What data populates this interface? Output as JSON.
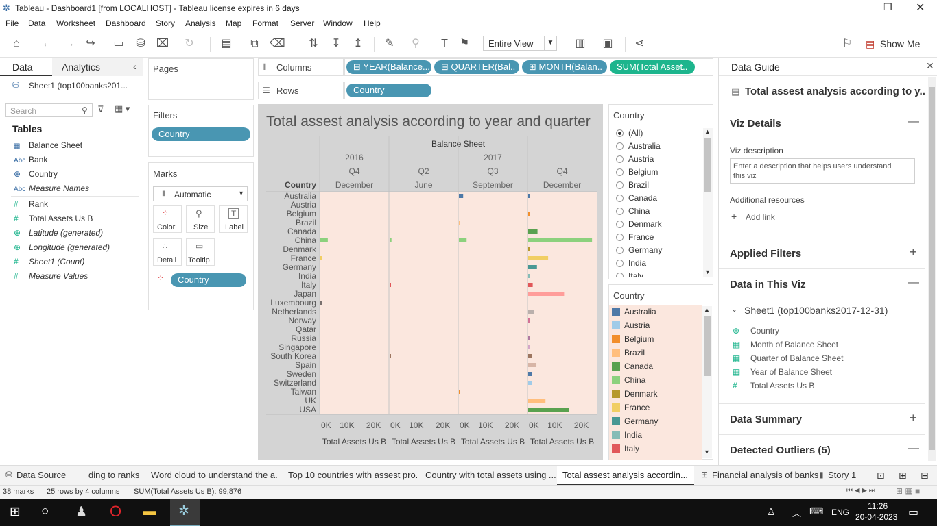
{
  "window": {
    "title": "Tableau - Dashboard1 [from LOCALHOST] - Tableau license expires in 6 days"
  },
  "menu": [
    "File",
    "Data",
    "Worksheet",
    "Dashboard",
    "Story",
    "Analysis",
    "Map",
    "Format",
    "Server",
    "Window",
    "Help"
  ],
  "toolbar": {
    "view_mode": "Entire View",
    "show_me": "Show Me"
  },
  "left_pane": {
    "tabs": [
      "Data",
      "Analytics"
    ],
    "datasource": "Sheet1 (top100banks201...",
    "search_placeholder": "Search",
    "tables_header": "Tables",
    "fields": [
      {
        "icon": "calendar",
        "name": "Balance Sheet",
        "italic": false
      },
      {
        "icon": "Abc",
        "name": "Bank",
        "italic": false
      },
      {
        "icon": "globe",
        "name": "Country",
        "italic": false
      },
      {
        "icon": "Abc",
        "name": "Measure Names",
        "italic": true
      },
      {
        "icon": "#",
        "name": "Rank",
        "italic": false
      },
      {
        "icon": "#",
        "name": "Total Assets Us B",
        "italic": false
      },
      {
        "icon": "globe",
        "name": "Latitude (generated)",
        "italic": true
      },
      {
        "icon": "globe",
        "name": "Longitude (generated)",
        "italic": true
      },
      {
        "icon": "#",
        "name": "Sheet1 (Count)",
        "italic": true
      },
      {
        "icon": "#",
        "name": "Measure Values",
        "italic": true
      }
    ]
  },
  "cards": {
    "pages": "Pages",
    "filters": "Filters",
    "filter_pill": "Country",
    "marks": "Marks",
    "marks_type": "Automatic",
    "mark_buttons": [
      "Color",
      "Size",
      "Label",
      "Detail",
      "Tooltip"
    ],
    "marks_pill": "Country"
  },
  "shelves": {
    "columns_label": "Columns",
    "rows_label": "Rows",
    "columns": [
      "YEAR(Balance...",
      "QUARTER(Bal..",
      "MONTH(Balan..",
      "SUM(Total Asset.."
    ],
    "rows": [
      "Country"
    ]
  },
  "chart_data": {
    "type": "bar",
    "title": "Total assest analysis according to year and quarter",
    "header_top": "Balance Sheet",
    "row_header": "Country",
    "categories": [
      "Australia",
      "Austria",
      "Belgium",
      "Brazil",
      "Canada",
      "China",
      "Denmark",
      "France",
      "Germany",
      "India",
      "Italy",
      "Japan",
      "Luxembourg",
      "Netherlands",
      "Norway",
      "Qatar",
      "Russia",
      "Singapore",
      "South Korea",
      "Spain",
      "Sweden",
      "Switzerland",
      "Taiwan",
      "UK",
      "USA"
    ],
    "panels": [
      {
        "year": "2016",
        "quarter": "Q4",
        "month": "December",
        "values": [
          0,
          0,
          0,
          0,
          0,
          2800,
          0,
          600,
          0,
          0,
          0,
          0,
          300,
          0,
          0,
          0,
          0,
          0,
          0,
          0,
          0,
          0,
          0,
          0,
          0
        ]
      },
      {
        "year": "",
        "quarter": "Q2",
        "month": "June",
        "values": [
          0,
          0,
          0,
          0,
          0,
          700,
          0,
          0,
          0,
          0,
          200,
          0,
          0,
          0,
          0,
          0,
          0,
          0,
          200,
          0,
          0,
          0,
          0,
          0,
          0
        ]
      },
      {
        "year": "2017",
        "quarter": "Q3",
        "month": "September",
        "values": [
          1600,
          0,
          0,
          300,
          0,
          2900,
          0,
          0,
          0,
          0,
          0,
          0,
          0,
          0,
          0,
          0,
          0,
          0,
          0,
          0,
          0,
          0,
          400,
          0,
          0
        ]
      },
      {
        "year": "",
        "quarter": "Q4",
        "month": "December",
        "values": [
          500,
          0,
          500,
          0,
          3500,
          24000,
          500,
          7500,
          3300,
          300,
          1700,
          13500,
          0,
          2100,
          300,
          0,
          400,
          700,
          1400,
          3100,
          1300,
          1400,
          0,
          6500,
          15300
        ]
      }
    ],
    "colors": [
      "#4e79a7",
      "#a0cbe8",
      "#f28e2b",
      "#ffbe7d",
      "#59a14f",
      "#8cd17d",
      "#b6992d",
      "#f1ce63",
      "#499894",
      "#86bcb6",
      "#e15759",
      "#ff9d9a",
      "#79706e",
      "#bab0ac",
      "#d37295",
      "#fabfd2",
      "#b07aa1",
      "#d4a6c8",
      "#9d7660",
      "#d7b5a6",
      "#4e79a7",
      "#a0cbe8",
      "#f28e2b",
      "#ffbe7d",
      "#59a14f"
    ],
    "xlim": [
      0,
      25000
    ],
    "ticks": [
      {
        "v": 0,
        "label": "0K"
      },
      {
        "v": 10000,
        "label": "10K"
      },
      {
        "v": 20000,
        "label": "20K"
      }
    ],
    "xlabel": "Total Assets Us B"
  },
  "country_filter": {
    "title": "Country",
    "options": [
      "(All)",
      "Australia",
      "Austria",
      "Belgium",
      "Brazil",
      "Canada",
      "China",
      "Denmark",
      "France",
      "Germany",
      "India",
      "Italy"
    ],
    "selected": "(All)"
  },
  "legend": {
    "title": "Country",
    "items": [
      {
        "name": "Australia",
        "color": "#4e79a7"
      },
      {
        "name": "Austria",
        "color": "#a0cbe8"
      },
      {
        "name": "Belgium",
        "color": "#f28e2b"
      },
      {
        "name": "Brazil",
        "color": "#ffbe7d"
      },
      {
        "name": "Canada",
        "color": "#59a14f"
      },
      {
        "name": "China",
        "color": "#8cd17d"
      },
      {
        "name": "Denmark",
        "color": "#b6992d"
      },
      {
        "name": "France",
        "color": "#f1ce63"
      },
      {
        "name": "Germany",
        "color": "#499894"
      },
      {
        "name": "India",
        "color": "#86bcb6"
      },
      {
        "name": "Italy",
        "color": "#e15759"
      }
    ]
  },
  "data_guide": {
    "title": "Data Guide",
    "sheet_title": "Total assest analysis according to y...",
    "viz_details": "Viz Details",
    "viz_description_label": "Viz description",
    "viz_description_placeholder": "Enter a description that helps users understand this viz",
    "additional_resources": "Additional resources",
    "add_link": "Add link",
    "applied_filters": "Applied Filters",
    "data_in_viz": "Data in This Viz",
    "datasource": "Sheet1 (top100banks2017-12-31)",
    "fields": [
      {
        "icon": "globe",
        "name": "Country"
      },
      {
        "icon": "calendar",
        "name": "Month of Balance Sheet"
      },
      {
        "icon": "calendar",
        "name": "Quarter of Balance Sheet"
      },
      {
        "icon": "calendar",
        "name": "Year of Balance Sheet"
      },
      {
        "icon": "#",
        "name": "Total Assets Us B"
      }
    ],
    "data_summary": "Data Summary",
    "detected_outliers": "Detected Outliers (5)"
  },
  "sheet_tabs": [
    "Data Source",
    "ding to ranks",
    "Word cloud to understand the a...",
    "Top 10 countries with assest pro...",
    "Country with total assets using ...",
    "Total assest analysis accordin...",
    "Financial analysis of banks",
    "Story 1"
  ],
  "status": {
    "marks": "38 marks",
    "dims": "25 rows by 4 columns",
    "sum": "SUM(Total Assets Us B): 99,876"
  },
  "taskbar": {
    "lang": "ENG",
    "time": "11:26",
    "date": "20-04-2023"
  },
  "accent": "#4996b2",
  "measure_pill_color": "#1db58d"
}
